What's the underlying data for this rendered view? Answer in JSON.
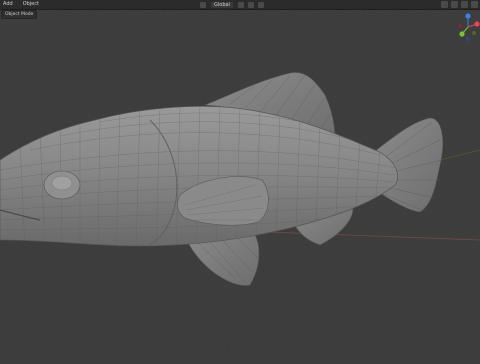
{
  "header": {
    "menu": [
      "Add",
      "Object"
    ],
    "view_mode": "Global",
    "mode_label": "Object Mode"
  },
  "viewport": {
    "object": "fish-mesh",
    "background": "#3d3d3d"
  },
  "gizmo": {
    "x_label": "X",
    "y_label": "Y",
    "z_label": "Z",
    "colors": {
      "x": "#e8465a",
      "y": "#7fbf3a",
      "z": "#3a7fe8"
    }
  }
}
